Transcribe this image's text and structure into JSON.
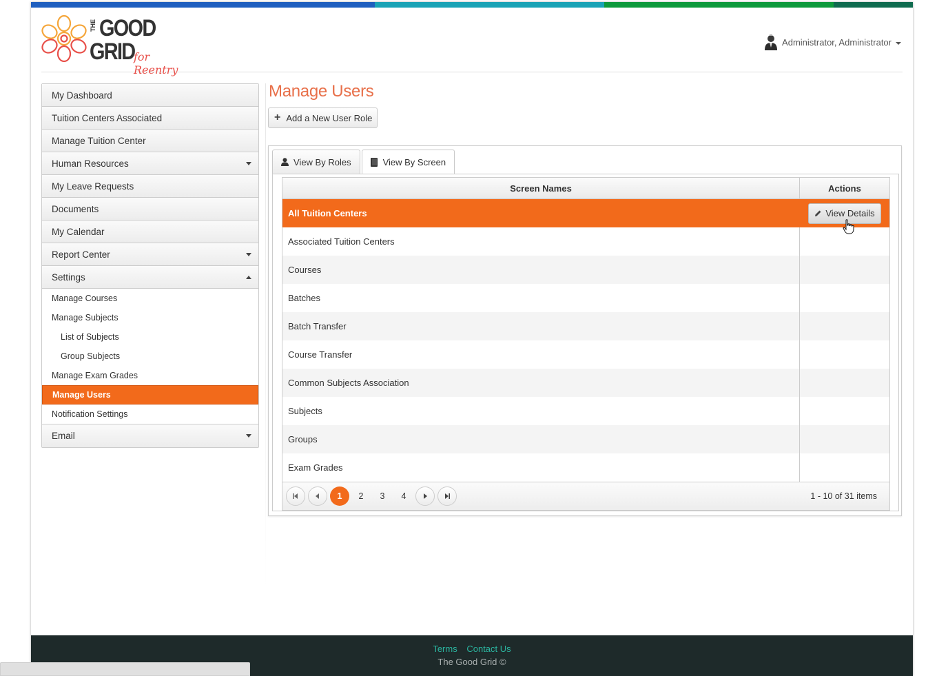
{
  "colors": {
    "accent": "#f26a1b",
    "title": "#e8704a",
    "footer_bg": "#1e2a2a",
    "footer_link": "#2bb5a0",
    "colorbar": [
      "#1f5fbf",
      "#1aa3b6",
      "#0e9a3c",
      "#0f6b4f"
    ]
  },
  "header": {
    "logo": {
      "line1": "THE",
      "line2": "GOOD",
      "line3": "GRID",
      "tagline": "for Reentry"
    },
    "user_menu_label": "Administrator, Administrator",
    "user_icon": "user-avatar-icon"
  },
  "sidebar": {
    "items": [
      {
        "label": "My Dashboard"
      },
      {
        "label": "Tuition Centers Associated"
      },
      {
        "label": "Manage Tuition Center"
      },
      {
        "label": "Human Resources"
      },
      {
        "label": "My Leave Requests"
      },
      {
        "label": "Documents"
      },
      {
        "label": "My Calendar"
      },
      {
        "label": "Report Center"
      },
      {
        "label": "Settings"
      },
      {
        "label": "Email"
      }
    ],
    "settings_sub": {
      "manage_courses": "Manage Courses",
      "manage_subjects": "Manage Subjects",
      "list_of_subjects": "List of Subjects",
      "group_subjects": "Group Subjects",
      "manage_exam_grades": "Manage Exam Grades",
      "manage_users": "Manage Users",
      "notification_settings": "Notification Settings"
    }
  },
  "main": {
    "title": "Manage Users",
    "add_button": "Add a New User Role",
    "tabs": [
      {
        "label": "View By Roles",
        "icon": "user-icon"
      },
      {
        "label": "View By Screen",
        "icon": "book-icon"
      }
    ],
    "grid": {
      "columns": [
        "Screen Names",
        "Actions"
      ],
      "rows": [
        "All Tuition Centers",
        "Associated Tuition Centers",
        "Courses",
        "Batches",
        "Batch Transfer",
        "Course Transfer",
        "Common Subjects Association",
        "Subjects",
        "Groups",
        "Exam Grades"
      ],
      "view_details_label": "View Details"
    },
    "pager": {
      "pages": [
        "1",
        "2",
        "3",
        "4"
      ],
      "current_page": "1",
      "info": "1 - 10 of 31 items"
    }
  },
  "footer": {
    "terms": "Terms",
    "contact": "Contact Us",
    "copyright": "The Good Grid ©"
  }
}
